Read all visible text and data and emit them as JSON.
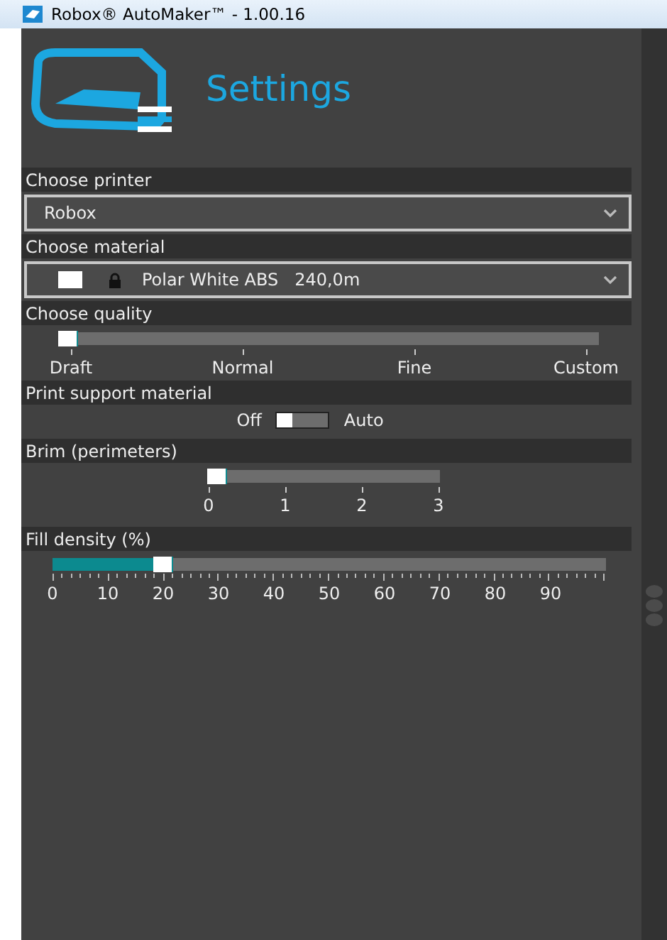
{
  "window": {
    "title": "Robox® AutoMaker™ - 1.00.16"
  },
  "header": {
    "title": "Settings"
  },
  "printer": {
    "label": "Choose printer",
    "value": "Robox"
  },
  "material": {
    "label": "Choose material",
    "color": "#ffffff",
    "locked": true,
    "value": "Polar White ABS   240,0m"
  },
  "quality": {
    "label": "Choose quality",
    "level": 0,
    "ticks": [
      "Draft",
      "Normal",
      "Fine",
      "Custom"
    ]
  },
  "support": {
    "label": "Print support material",
    "off_label": "Off",
    "on_label": "Auto",
    "on": false
  },
  "brim": {
    "label": "Brim (perimeters)",
    "level": 0,
    "ticks": [
      "0",
      "1",
      "2",
      "3"
    ]
  },
  "fill": {
    "label": "Fill density (%)",
    "level": 0.2,
    "ticks": [
      "0",
      "10",
      "20",
      "30",
      "40",
      "50",
      "60",
      "70",
      "80",
      "90"
    ]
  }
}
